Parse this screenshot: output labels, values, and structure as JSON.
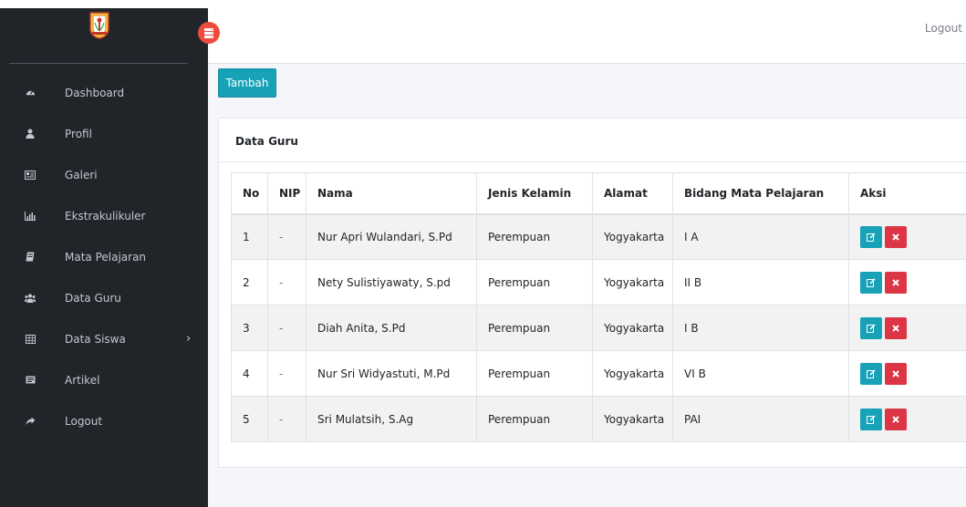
{
  "sidebar": {
    "logo_icon": "school-emblem-icon",
    "items": [
      {
        "label": "Dashboard",
        "icon": "tachometer-icon"
      },
      {
        "label": "Profil",
        "icon": "user-icon"
      },
      {
        "label": "Galeri",
        "icon": "image-gallery-icon"
      },
      {
        "label": "Ekstrakulikuler",
        "icon": "bar-chart-icon"
      },
      {
        "label": "Mata Pelajaran",
        "icon": "book-icon"
      },
      {
        "label": "Data Guru",
        "icon": "users-icon"
      },
      {
        "label": "Data Siswa",
        "icon": "table-icon",
        "caret": "›"
      },
      {
        "label": "Artikel",
        "icon": "newspaper-icon"
      },
      {
        "label": "Logout",
        "icon": "share-arrow-icon"
      }
    ]
  },
  "topbar": {
    "logout_label": "Logout"
  },
  "toolbar": {
    "tambah_label": "Tambah"
  },
  "card": {
    "title": "Data Guru"
  },
  "table": {
    "headers": [
      "No",
      "NIP",
      "Nama",
      "Jenis Kelamin",
      "Alamat",
      "Bidang Mata Pelajaran",
      "Aksi"
    ],
    "rows": [
      [
        "1",
        "-",
        "Nur Apri Wulandari, S.Pd",
        "Perempuan",
        "Yogyakarta",
        "I A"
      ],
      [
        "2",
        "-",
        "Nety Sulistiyawaty, S.pd",
        "Perempuan",
        "Yogyakarta",
        "II B"
      ],
      [
        "3",
        "-",
        "Diah Anita, S.Pd",
        "Perempuan",
        "Yogyakarta",
        "I B"
      ],
      [
        "4",
        "-",
        "Nur Sri Widyastuti, M.Pd",
        "Perempuan",
        "Yogyakarta",
        "VI B"
      ],
      [
        "5",
        "-",
        "Sri Mulatsih, S.Ag",
        "Perempuan",
        "Yogyakarta",
        "PAI"
      ]
    ]
  },
  "colors": {
    "sidebar_bg": "#212529",
    "accent_info": "#17a2b8",
    "danger": "#dc3545",
    "toggle": "#ee4b3f"
  }
}
